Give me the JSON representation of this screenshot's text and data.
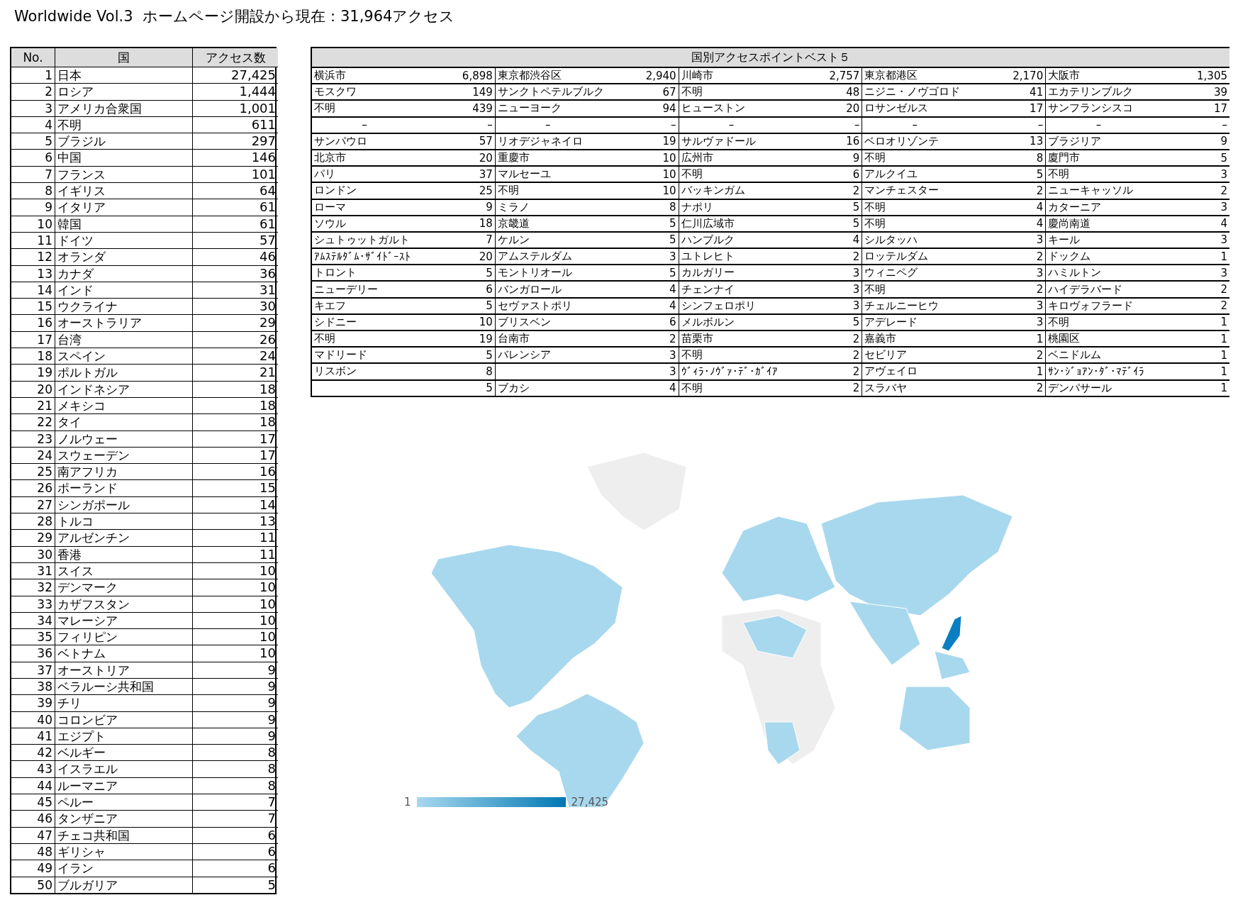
{
  "title": "Worldwide Vol.3  ホームページ開設から現在：31,964アクセス",
  "countries": {
    "columns": [
      "No.",
      "国",
      "アクセス数"
    ],
    "rows": [
      {
        "no": "1",
        "name": "日本",
        "count": "27,425"
      },
      {
        "no": "2",
        "name": "ロシア",
        "count": "1,444"
      },
      {
        "no": "3",
        "name": "アメリカ合衆国",
        "count": "1,001"
      },
      {
        "no": "4",
        "name": "不明",
        "count": "611"
      },
      {
        "no": "5",
        "name": "ブラジル",
        "count": "297"
      },
      {
        "no": "6",
        "name": "中国",
        "count": "146"
      },
      {
        "no": "7",
        "name": "フランス",
        "count": "101"
      },
      {
        "no": "8",
        "name": "イギリス",
        "count": "64"
      },
      {
        "no": "9",
        "name": "イタリア",
        "count": "61"
      },
      {
        "no": "10",
        "name": "韓国",
        "count": "61"
      },
      {
        "no": "11",
        "name": "ドイツ",
        "count": "57"
      },
      {
        "no": "12",
        "name": "オランダ",
        "count": "46"
      },
      {
        "no": "13",
        "name": "カナダ",
        "count": "36"
      },
      {
        "no": "14",
        "name": "インド",
        "count": "31"
      },
      {
        "no": "15",
        "name": "ウクライナ",
        "count": "30"
      },
      {
        "no": "16",
        "name": "オーストラリア",
        "count": "29"
      },
      {
        "no": "17",
        "name": "台湾",
        "count": "26"
      },
      {
        "no": "18",
        "name": "スペイン",
        "count": "24"
      },
      {
        "no": "19",
        "name": "ポルトガル",
        "count": "21"
      },
      {
        "no": "20",
        "name": "インドネシア",
        "count": "18"
      },
      {
        "no": "21",
        "name": "メキシコ",
        "count": "18"
      },
      {
        "no": "22",
        "name": "タイ",
        "count": "18"
      },
      {
        "no": "23",
        "name": "ノルウェー",
        "count": "17"
      },
      {
        "no": "24",
        "name": "スウェーデン",
        "count": "17"
      },
      {
        "no": "25",
        "name": "南アフリカ",
        "count": "16"
      },
      {
        "no": "26",
        "name": "ポーランド",
        "count": "15"
      },
      {
        "no": "27",
        "name": "シンガポール",
        "count": "14"
      },
      {
        "no": "28",
        "name": "トルコ",
        "count": "13"
      },
      {
        "no": "29",
        "name": "アルゼンチン",
        "count": "11"
      },
      {
        "no": "30",
        "name": "香港",
        "count": "11"
      },
      {
        "no": "31",
        "name": "スイス",
        "count": "10"
      },
      {
        "no": "32",
        "name": "デンマーク",
        "count": "10"
      },
      {
        "no": "33",
        "name": "カザフスタン",
        "count": "10"
      },
      {
        "no": "34",
        "name": "マレーシア",
        "count": "10"
      },
      {
        "no": "35",
        "name": "フィリピン",
        "count": "10"
      },
      {
        "no": "36",
        "name": "ベトナム",
        "count": "10"
      },
      {
        "no": "37",
        "name": "オーストリア",
        "count": "9"
      },
      {
        "no": "38",
        "name": "ベラルーシ共和国",
        "count": "9"
      },
      {
        "no": "39",
        "name": "チリ",
        "count": "9"
      },
      {
        "no": "40",
        "name": "コロンビア",
        "count": "9"
      },
      {
        "no": "41",
        "name": "エジプト",
        "count": "9"
      },
      {
        "no": "42",
        "name": "ベルギー",
        "count": "8"
      },
      {
        "no": "43",
        "name": "イスラエル",
        "count": "8"
      },
      {
        "no": "44",
        "name": "ルーマニア",
        "count": "8"
      },
      {
        "no": "45",
        "name": "ペルー",
        "count": "7"
      },
      {
        "no": "46",
        "name": "タンザニア",
        "count": "7"
      },
      {
        "no": "47",
        "name": "チェコ共和国",
        "count": "6"
      },
      {
        "no": "48",
        "name": "ギリシャ",
        "count": "6"
      },
      {
        "no": "49",
        "name": "イラン",
        "count": "6"
      },
      {
        "no": "50",
        "name": "ブルガリア",
        "count": "5"
      }
    ]
  },
  "cities": {
    "title": "国別アクセスポイントベスト５",
    "rows": [
      [
        {
          "name": "横浜市",
          "count": "6,898"
        },
        {
          "name": "東京都渋谷区",
          "count": "2,940"
        },
        {
          "name": "川崎市",
          "count": "2,757"
        },
        {
          "name": "東京都港区",
          "count": "2,170"
        },
        {
          "name": "大阪市",
          "count": "1,305"
        }
      ],
      [
        {
          "name": "モスクワ",
          "count": "149"
        },
        {
          "name": "サンクトペテルブルク",
          "count": "67"
        },
        {
          "name": "不明",
          "count": "48"
        },
        {
          "name": "ニジニ・ノヴゴロド",
          "count": "41"
        },
        {
          "name": "エカテリンブルク",
          "count": "39"
        }
      ],
      [
        {
          "name": "不明",
          "count": "439"
        },
        {
          "name": "ニューヨーク",
          "count": "94"
        },
        {
          "name": "ヒューストン",
          "count": "20"
        },
        {
          "name": "ロサンゼルス",
          "count": "17"
        },
        {
          "name": "サンフランシスコ",
          "count": "17"
        }
      ],
      [
        {
          "name": "–",
          "count": "–"
        },
        {
          "name": "–",
          "count": "–"
        },
        {
          "name": "–",
          "count": "–"
        },
        {
          "name": "–",
          "count": "–"
        },
        {
          "name": "–",
          "count": "–"
        }
      ],
      [
        {
          "name": "サンパウロ",
          "count": "57"
        },
        {
          "name": "リオデジャネイロ",
          "count": "19"
        },
        {
          "name": "サルヴァドール",
          "count": "16"
        },
        {
          "name": "ベロオリゾンテ",
          "count": "13"
        },
        {
          "name": "ブラジリア",
          "count": "9"
        }
      ],
      [
        {
          "name": "北京市",
          "count": "20"
        },
        {
          "name": "重慶市",
          "count": "10"
        },
        {
          "name": "広州市",
          "count": "9"
        },
        {
          "name": "不明",
          "count": "8"
        },
        {
          "name": "廈門市",
          "count": "5"
        }
      ],
      [
        {
          "name": "パリ",
          "count": "37"
        },
        {
          "name": "マルセーユ",
          "count": "10"
        },
        {
          "name": "不明",
          "count": "6"
        },
        {
          "name": "アルクイユ",
          "count": "5"
        },
        {
          "name": "不明",
          "count": "3"
        }
      ],
      [
        {
          "name": "ロンドン",
          "count": "25"
        },
        {
          "name": "不明",
          "count": "10"
        },
        {
          "name": "バッキンガム",
          "count": "2"
        },
        {
          "name": "マンチェスター",
          "count": "2"
        },
        {
          "name": "ニューキャッソル",
          "count": "2"
        }
      ],
      [
        {
          "name": "ローマ",
          "count": "9"
        },
        {
          "name": "ミラノ",
          "count": "8"
        },
        {
          "name": "ナポリ",
          "count": "5"
        },
        {
          "name": "不明",
          "count": "4"
        },
        {
          "name": "カターニア",
          "count": "3"
        }
      ],
      [
        {
          "name": "ソウル",
          "count": "18"
        },
        {
          "name": "京畿道",
          "count": "5"
        },
        {
          "name": "仁川広域市",
          "count": "5"
        },
        {
          "name": "不明",
          "count": "4"
        },
        {
          "name": "慶尚南道",
          "count": "4"
        }
      ],
      [
        {
          "name": "シュトゥットガルト",
          "count": "7"
        },
        {
          "name": "ケルン",
          "count": "5"
        },
        {
          "name": "ハンブルク",
          "count": "4"
        },
        {
          "name": "シルタッハ",
          "count": "3"
        },
        {
          "name": "キール",
          "count": "3"
        }
      ],
      [
        {
          "name": "ｱﾑｽﾃﾙﾀﾞﾑ･ｻﾞｲﾄﾞｰｽﾄ",
          "count": "20"
        },
        {
          "name": "アムステルダム",
          "count": "3"
        },
        {
          "name": "ユトレヒト",
          "count": "2"
        },
        {
          "name": "ロッテルダム",
          "count": "2"
        },
        {
          "name": "ドックム",
          "count": "1"
        }
      ],
      [
        {
          "name": "トロント",
          "count": "5"
        },
        {
          "name": "モントリオール",
          "count": "5"
        },
        {
          "name": "カルガリー",
          "count": "3"
        },
        {
          "name": "ウィニペグ",
          "count": "3"
        },
        {
          "name": "ハミルトン",
          "count": "3"
        }
      ],
      [
        {
          "name": "ニューデリー",
          "count": "6"
        },
        {
          "name": "バンガロール",
          "count": "4"
        },
        {
          "name": "チェンナイ",
          "count": "3"
        },
        {
          "name": "不明",
          "count": "2"
        },
        {
          "name": "ハイデラバード",
          "count": "2"
        }
      ],
      [
        {
          "name": "キエフ",
          "count": "5"
        },
        {
          "name": "セヴァストポリ",
          "count": "4"
        },
        {
          "name": "シンフェロポリ",
          "count": "3"
        },
        {
          "name": "チェルニーヒウ",
          "count": "3"
        },
        {
          "name": "キロヴォフラード",
          "count": "2"
        }
      ],
      [
        {
          "name": "シドニー",
          "count": "10"
        },
        {
          "name": "ブリスベン",
          "count": "6"
        },
        {
          "name": "メルボルン",
          "count": "5"
        },
        {
          "name": "アデレード",
          "count": "3"
        },
        {
          "name": "不明",
          "count": "1"
        }
      ],
      [
        {
          "name": "不明",
          "count": "19"
        },
        {
          "name": "台南市",
          "count": "2"
        },
        {
          "name": "苗栗市",
          "count": "2"
        },
        {
          "name": "嘉義市",
          "count": "1"
        },
        {
          "name": "桃園区",
          "count": "1"
        }
      ],
      [
        {
          "name": "マドリード",
          "count": "5"
        },
        {
          "name": "バレンシア",
          "count": "3"
        },
        {
          "name": "不明",
          "count": "2"
        },
        {
          "name": "セビリア",
          "count": "2"
        },
        {
          "name": "ベニドルム",
          "count": "1"
        }
      ],
      [
        {
          "name": "リスボン",
          "count": "8"
        },
        {
          "count": "3"
        },
        {
          "name": "ｳﾞｨﾗ･ﾉｳﾞｧ･ﾃﾞ･ｶﾞｲｱ",
          "count": "2"
        },
        {
          "name": "アヴェイロ",
          "count": "1"
        },
        {
          "name": "ｻﾝ･ｼﾞｮｱﾝ･ﾀﾞ･ﾏﾃﾞｲﾗ",
          "count": "1"
        }
      ],
      [
        {
          "count": "5"
        },
        {
          "name": "ブカシ",
          "count": "4"
        },
        {
          "name": "不明",
          "count": "2"
        },
        {
          "name": "スラバヤ",
          "count": "2"
        },
        {
          "name": "デンパサール",
          "count": "1"
        }
      ]
    ]
  },
  "map": {
    "legend_min": "1",
    "legend_max": "27,425"
  }
}
